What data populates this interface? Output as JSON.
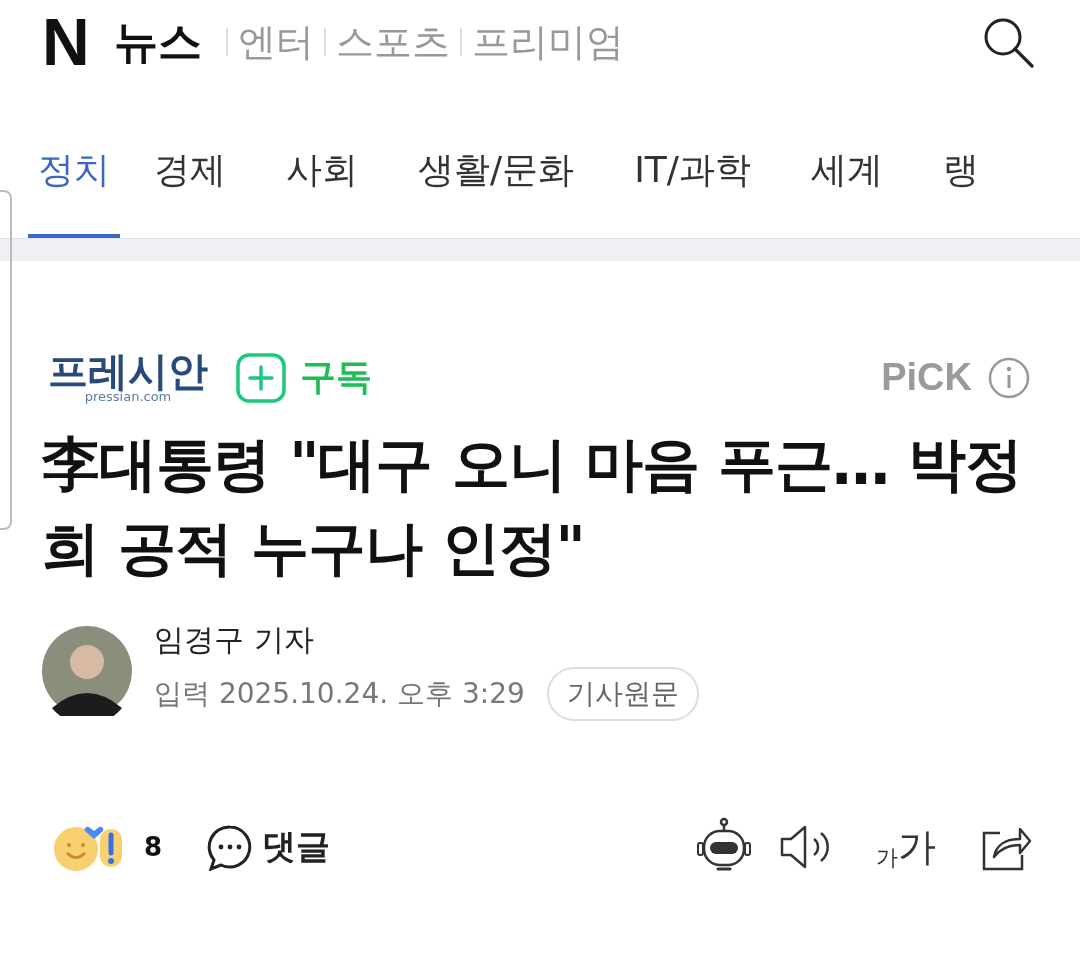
{
  "header": {
    "logo": "N",
    "title": "뉴스",
    "links": [
      "엔터",
      "스포츠",
      "프리미엄"
    ]
  },
  "tabs": [
    {
      "label": "정치",
      "selected": true
    },
    {
      "label": "경제",
      "selected": false
    },
    {
      "label": "사회",
      "selected": false
    },
    {
      "label": "생활/문화",
      "selected": false
    },
    {
      "label": "IT/과학",
      "selected": false
    },
    {
      "label": "세계",
      "selected": false
    },
    {
      "label": "랭",
      "selected": false
    }
  ],
  "press": {
    "name": "프레시안",
    "domain": "pressian.com",
    "subscribe": "구독",
    "badge": "PiCK"
  },
  "headline": "李대통령 \"대구 오니 마음 푸근… 박정희 공적 누구나 인정\"",
  "byline": {
    "reporter": "임경구 기자",
    "date_label": "입력",
    "date": "2025.10.24. 오후 3:29",
    "original_button": "기사원문"
  },
  "actions": {
    "reaction_count": "8",
    "comment": "댓글",
    "font_small": "가",
    "font_large": "가"
  }
}
